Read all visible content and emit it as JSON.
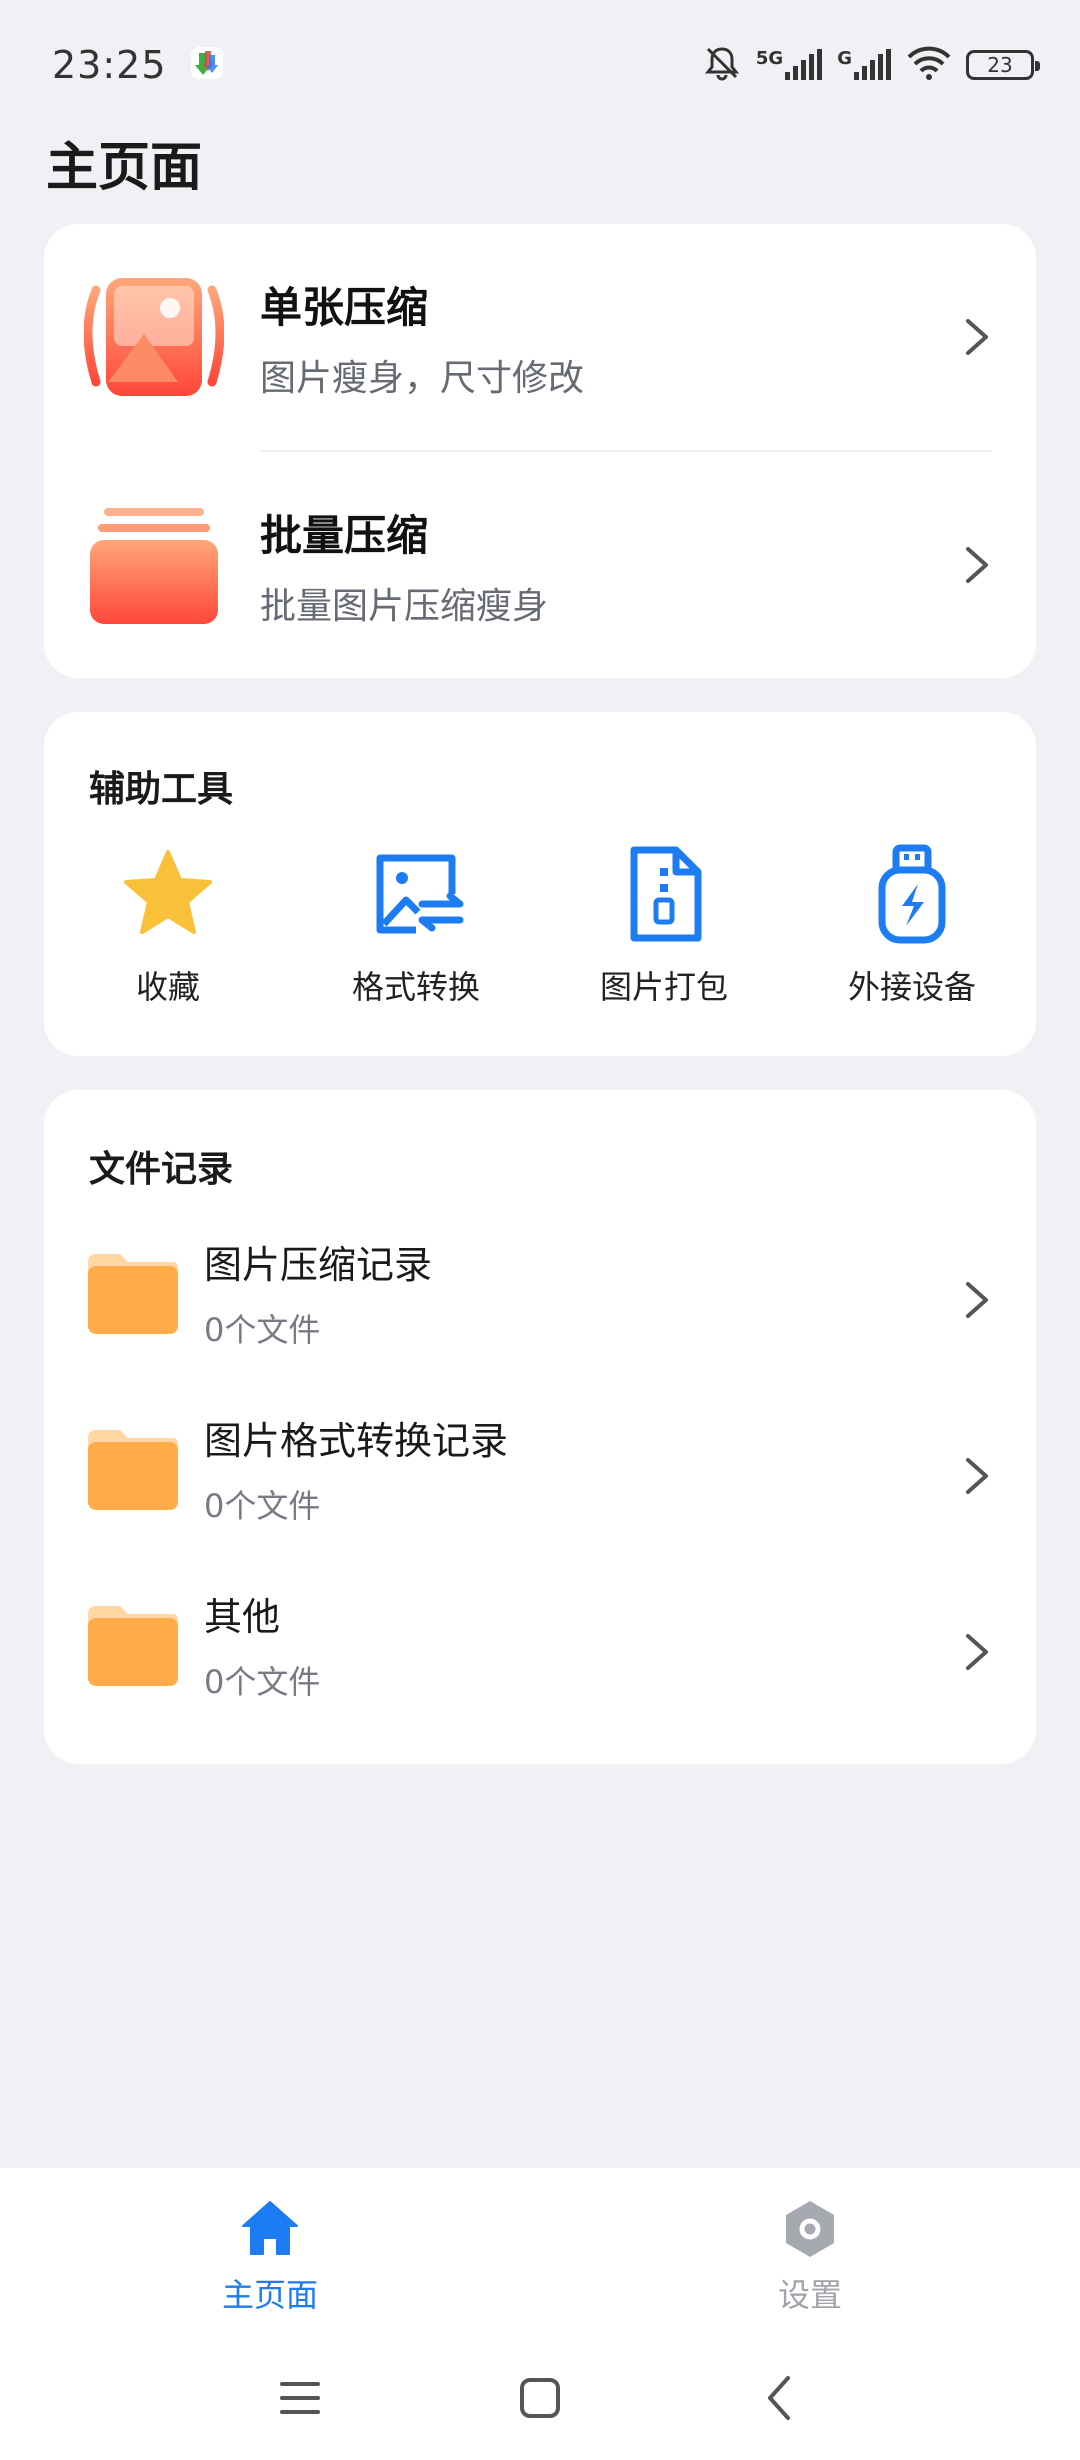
{
  "status_bar": {
    "time": "23:25",
    "network_1": "5G",
    "network_2": "G",
    "battery": "23"
  },
  "page": {
    "title": "主页面"
  },
  "main_actions": [
    {
      "title": "单张压缩",
      "subtitle": "图片瘦身，尺寸修改",
      "icon": "image-compress-icon"
    },
    {
      "title": "批量压缩",
      "subtitle": "批量图片压缩瘦身",
      "icon": "batch-stack-icon"
    }
  ],
  "tools": {
    "title": "辅助工具",
    "items": [
      {
        "label": "收藏",
        "icon": "star-icon"
      },
      {
        "label": "格式转换",
        "icon": "image-convert-icon"
      },
      {
        "label": "图片打包",
        "icon": "zip-file-icon"
      },
      {
        "label": "外接设备",
        "icon": "usb-drive-icon"
      }
    ]
  },
  "records": {
    "title": "文件记录",
    "items": [
      {
        "title": "图片压缩记录",
        "count": "0个文件"
      },
      {
        "title": "图片格式转换记录",
        "count": "0个文件"
      },
      {
        "title": "其他",
        "count": "0个文件"
      }
    ]
  },
  "bottom_nav": {
    "home_label": "主页面",
    "settings_label": "设置"
  },
  "colors": {
    "accent": "#1e7cf2",
    "folder": "#ffab47",
    "star": "#f9c03a",
    "gradient_top": "#ff9a6a",
    "gradient_bottom": "#ff4a3b"
  }
}
